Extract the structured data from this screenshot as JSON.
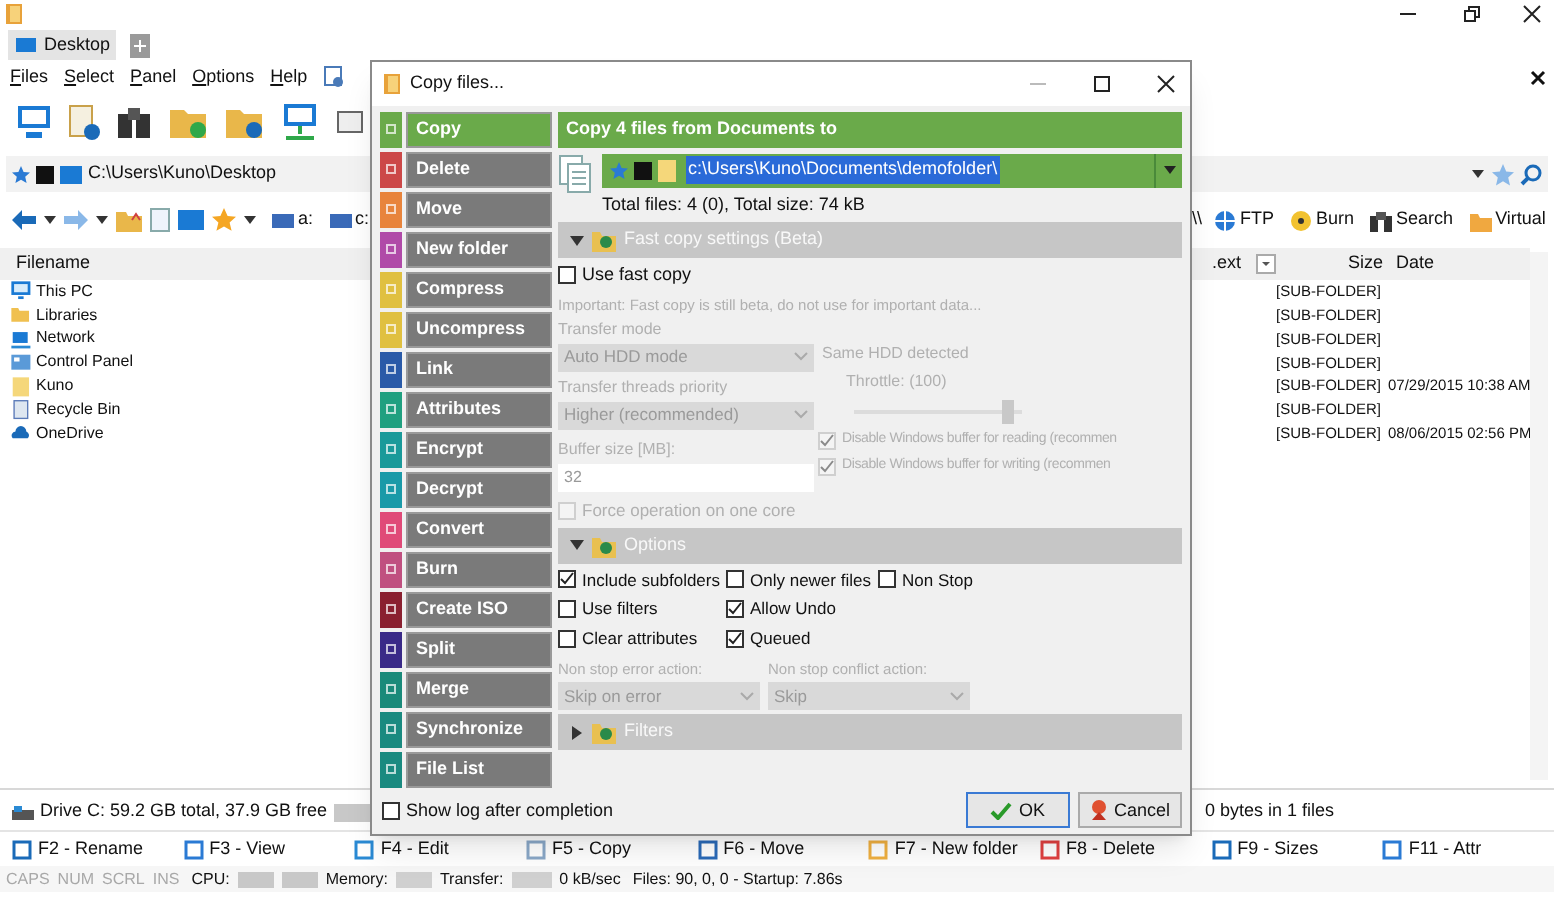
{
  "tabs": [
    {
      "label": "Desktop",
      "selected": true
    }
  ],
  "menu": [
    "Files",
    "Select",
    "Panel",
    "Options",
    "Help"
  ],
  "address_bar": {
    "path": "C:\\Users\\Kuno\\Desktop"
  },
  "drive_buttons": [
    "a:",
    "c:"
  ],
  "network_prefix": "\\\\",
  "quick_links": [
    {
      "label": "FTP",
      "kind": "ftp"
    },
    {
      "label": "Burn",
      "kind": "burn"
    },
    {
      "label": "Search",
      "kind": "search"
    },
    {
      "label": "Virtual",
      "kind": "virtual"
    }
  ],
  "file_list": {
    "columns": [
      "Filename",
      ".ext",
      "Size",
      "Date"
    ],
    "rows": [
      {
        "name": "This PC",
        "kind": "pc",
        "size": "[SUB-FOLDER]"
      },
      {
        "name": "Libraries",
        "kind": "library",
        "size": "[SUB-FOLDER]"
      },
      {
        "name": "Network",
        "kind": "network",
        "size": "[SUB-FOLDER]"
      },
      {
        "name": "Control Panel",
        "kind": "control-panel",
        "size": "[SUB-FOLDER]"
      },
      {
        "name": "Kuno",
        "kind": "folder",
        "size": "[SUB-FOLDER]",
        "date": "07/29/2015 10:38 AM"
      },
      {
        "name": "Recycle Bin",
        "kind": "recycle-bin",
        "size": "[SUB-FOLDER]"
      },
      {
        "name": "OneDrive",
        "kind": "cloud",
        "size": "[SUB-FOLDER]",
        "date": "08/06/2015 02:56 PM"
      }
    ]
  },
  "drive_info": "Drive C: 59.2 GB total, 37.9 GB free",
  "selection_info": "0 bytes in 1 files",
  "function_keys": [
    {
      "label": "F2 - Rename",
      "kind": "rename"
    },
    {
      "label": "F3 - View",
      "kind": "view"
    },
    {
      "label": "F4 - Edit",
      "kind": "edit"
    },
    {
      "label": "F5 - Copy",
      "kind": "copy"
    },
    {
      "label": "F6 - Move",
      "kind": "move"
    },
    {
      "label": "F7 - New folder",
      "kind": "folder"
    },
    {
      "label": "F8 - Delete",
      "kind": "delete"
    },
    {
      "label": "F9 - Sizes",
      "kind": "sizes"
    },
    {
      "label": "F11 - Attr",
      "kind": "attr"
    }
  ],
  "status_bar": {
    "indicators": [
      {
        "label": "CAPS",
        "on": false
      },
      {
        "label": "NUM",
        "on": false
      },
      {
        "label": "SCRL",
        "on": false
      },
      {
        "label": "INS",
        "on": false
      }
    ],
    "cpu_label": "CPU:",
    "memory_label": "Memory:",
    "transfer_label": "Transfer:",
    "speed": "0 kB/sec",
    "files": "Files: 90, 0, 0 - Startup: 7.86s"
  },
  "dialog": {
    "title": "Copy files...",
    "operations": [
      {
        "label": "Copy",
        "color": "#6aaa4a",
        "selected": true
      },
      {
        "label": "Delete",
        "color": "#cc4848",
        "selected": false
      },
      {
        "label": "Move",
        "color": "#e8843c",
        "selected": false
      },
      {
        "label": "New folder",
        "color": "#b04aa8",
        "selected": false
      },
      {
        "label": "Compress",
        "color": "#e0c040",
        "selected": false
      },
      {
        "label": "Uncompress",
        "color": "#e0c040",
        "selected": false
      },
      {
        "label": "Link",
        "color": "#2a5aa8",
        "selected": false
      },
      {
        "label": "Attributes",
        "color": "#20a080",
        "selected": false
      },
      {
        "label": "Encrypt",
        "color": "#1a9a9a",
        "selected": false
      },
      {
        "label": "Decrypt",
        "color": "#1a9aa8",
        "selected": false
      },
      {
        "label": "Convert",
        "color": "#e04a78",
        "selected": false
      },
      {
        "label": "Burn",
        "color": "#c05080",
        "selected": false
      },
      {
        "label": "Create ISO",
        "color": "#8a2030",
        "selected": false
      },
      {
        "label": "Split",
        "color": "#3a2a88",
        "selected": false
      },
      {
        "label": "Merge",
        "color": "#1a8a7a",
        "selected": false
      },
      {
        "label": "Synchronize",
        "color": "#1a8a80",
        "selected": false
      },
      {
        "label": "File List",
        "color": "#1a8a80",
        "selected": false
      }
    ],
    "header": "Copy 4 files from Documents to",
    "destination": "c:\\Users\\Kuno\\Documents\\demofolder\\",
    "summary": "Total files: 4 (0), Total size: 74 kB",
    "fast_copy": {
      "title": "Fast copy settings (Beta)",
      "expanded": true,
      "disabled": true,
      "use_fast_copy": {
        "label": "Use fast copy",
        "checked": false
      },
      "note": "Important: Fast copy is still beta, do not use for important data...",
      "transfer_mode": {
        "label": "Transfer mode",
        "value": "Auto HDD mode",
        "hint": "Same HDD detected"
      },
      "threads": {
        "label": "Transfer threads priority",
        "value": "Higher (recommended)"
      },
      "throttle": {
        "label": "Throttle: (100)",
        "level": 0.95
      },
      "buffer": {
        "label": "Buffer size [MB]:",
        "value": "32"
      },
      "disable_read": {
        "label": "Disable Windows buffer for reading (recommen",
        "checked": true
      },
      "disable_write": {
        "label": "Disable Windows buffer for writing (recommen",
        "checked": true
      },
      "force_one_core": {
        "label": "Force operation on one core",
        "checked": false
      }
    },
    "options": {
      "title": "Options",
      "expanded": true,
      "columns": [
        [
          {
            "label": "Include subfolders",
            "checked": true
          },
          {
            "label": "Use filters",
            "checked": false
          },
          {
            "label": "Clear attributes",
            "checked": false
          }
        ],
        [
          {
            "label": "Only newer files",
            "checked": false
          },
          {
            "label": "Allow Undo",
            "checked": true
          },
          {
            "label": "Queued",
            "checked": true
          }
        ],
        [
          {
            "label": "Non Stop",
            "checked": false
          }
        ]
      ],
      "error_action": {
        "label": "Non stop error action:",
        "value": "Skip on error",
        "disabled": true
      },
      "conflict_action": {
        "label": "Non stop conflict action:",
        "value": "Skip",
        "disabled": true
      }
    },
    "filters": {
      "title": "Filters",
      "expanded": false
    },
    "show_log": {
      "label": "Show log after completion",
      "checked": false
    },
    "buttons": [
      {
        "label": "OK",
        "kind": "ok"
      },
      {
        "label": "Cancel",
        "kind": "cancel"
      }
    ]
  }
}
